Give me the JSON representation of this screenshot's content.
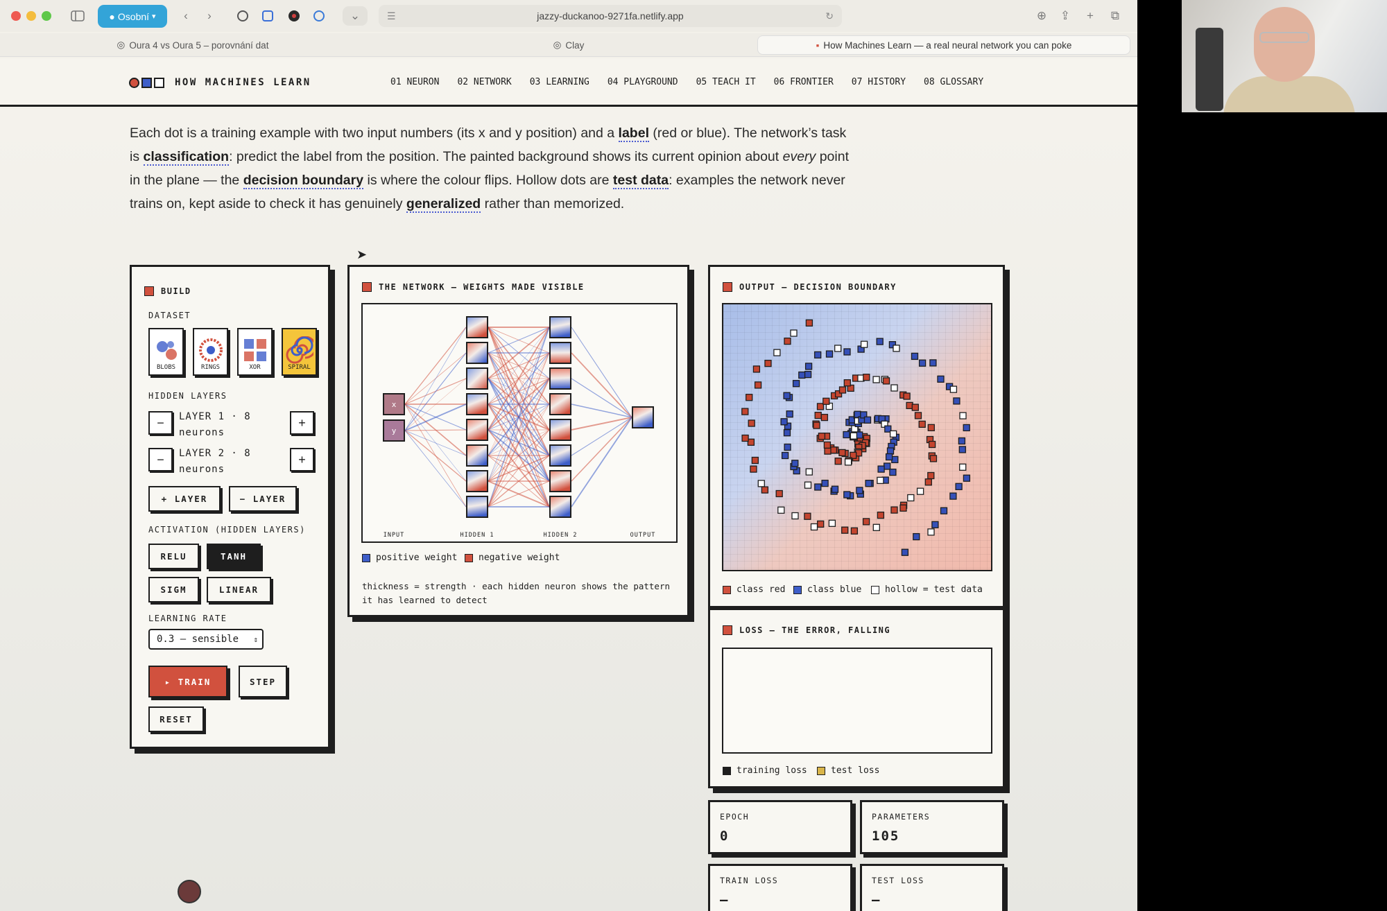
{
  "browser": {
    "profile_label": "Osobní",
    "url": "jazzy-duckanoo-9271fa.netlify.app",
    "tabs": [
      {
        "label": "Oura 4 vs Oura 5 – porovnání dat"
      },
      {
        "label": "Clay"
      },
      {
        "label": "How Machines Learn — a real neural network you can poke"
      }
    ]
  },
  "site": {
    "logo_text": "HOW MACHINES LEARN",
    "nav": [
      "01 NEURON",
      "02 NETWORK",
      "03 LEARNING",
      "04 PLAYGROUND",
      "05 TEACH IT",
      "06 FRONTIER",
      "07 HISTORY",
      "08 GLOSSARY"
    ]
  },
  "intro": {
    "p1": "Each dot is a training example with two input numbers (its x and y position) and a ",
    "t_label": "label",
    "p2": " (red or blue). The network’s task is ",
    "t_classification": "classification",
    "p3": ": predict the label from the position. The painted background shows its current opinion about ",
    "em_every": "every",
    "p4": " point in the plane — the ",
    "t_decision": "decision boundary",
    "p5": " is where the colour flips. Hollow dots are ",
    "t_test": "test data",
    "p6": ": examples the network never trains on, kept aside to check it has genuinely ",
    "t_generalized": "generalized",
    "p7": " rather than memorized."
  },
  "build": {
    "title": "BUILD",
    "dataset_label": "DATASET",
    "datasets": [
      "BLOBS",
      "RINGS",
      "XOR",
      "SPIRAL"
    ],
    "selected_dataset": "SPIRAL",
    "hidden_layers_label": "HIDDEN LAYERS",
    "layers": [
      {
        "line1": "LAYER 1 · 8",
        "line2": "neurons"
      },
      {
        "line1": "LAYER 2 · 8",
        "line2": "neurons"
      }
    ],
    "minus": "−",
    "plus": "+",
    "add_layer": "+ LAYER",
    "remove_layer": "− LAYER",
    "activation_label": "ACTIVATION (HIDDEN LAYERS)",
    "activations": [
      "RELU",
      "TANH",
      "SIGM",
      "LINEAR"
    ],
    "selected_activation": "TANH",
    "lr_label": "LEARNING RATE",
    "lr_value": "0.3 — sensible",
    "train": "▸ TRAIN",
    "step": "STEP",
    "reset": "RESET"
  },
  "network": {
    "title": "THE NETWORK — WEIGHTS MADE VISIBLE",
    "inputs": [
      "x",
      "y"
    ],
    "col_labels": [
      "INPUT",
      "HIDDEN 1",
      "HIDDEN 2",
      "OUTPUT"
    ],
    "legend_positive": "positive weight",
    "legend_negative": "negative weight",
    "caption": "thickness = strength · each hidden neuron shows the pattern it has learned to detect",
    "colors": {
      "positive": "#3e5ec9",
      "negative": "#d1513e"
    }
  },
  "output": {
    "title": "OUTPUT — DECISION BOUNDARY",
    "legend_red": "class red",
    "legend_blue": "class blue",
    "legend_hollow": "hollow = test data"
  },
  "loss": {
    "title": "LOSS — THE ERROR, FALLING",
    "legend_train": "training loss",
    "legend_test": "test loss"
  },
  "stats": {
    "epoch_label": "EPOCH",
    "epoch": "0",
    "params_label": "PARAMETERS",
    "params": "105",
    "train_loss_label": "TRAIN LOSS",
    "train_loss": "—",
    "test_loss_label": "TEST LOSS",
    "test_loss": "—"
  }
}
